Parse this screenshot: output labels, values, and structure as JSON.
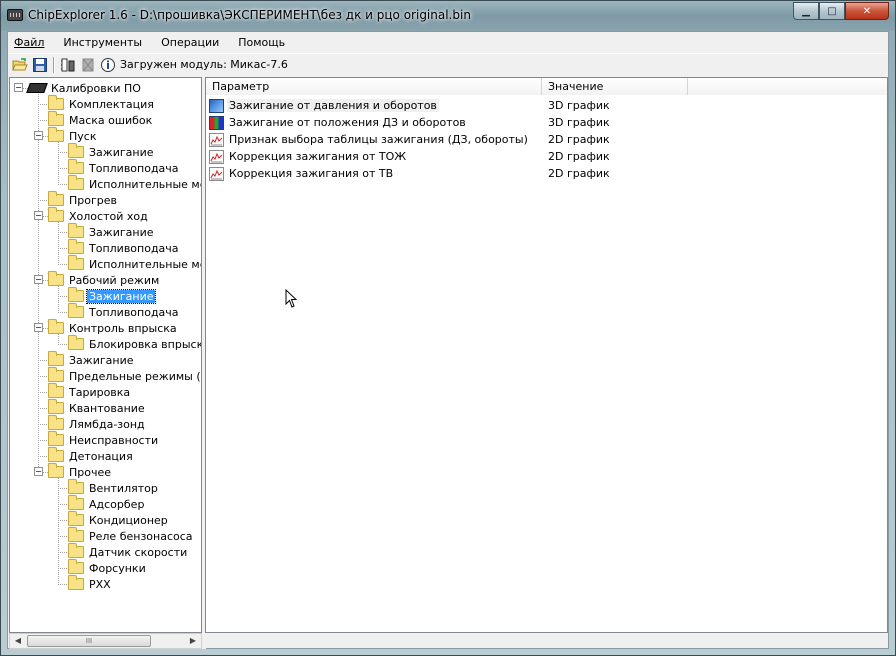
{
  "window": {
    "title": "ChipExplorer  1.6 - D:\\прошивка\\ЭКСПЕРИМЕНТ\\без дк и рцо original.bin",
    "minimize_glyph": "▁",
    "maximize_glyph": "□",
    "close_glyph": "✕"
  },
  "menu": {
    "items": [
      "Файл",
      "Инструменты",
      "Операции",
      "Помощь"
    ]
  },
  "toolbar": {
    "status": "Загружен модуль: Микас-7.6"
  },
  "tree": {
    "items": [
      {
        "label": "Калибровки ПО",
        "level": 0,
        "expander": "−",
        "icon": "chip"
      },
      {
        "label": "Комплектация",
        "level": 1,
        "expander": "",
        "icon": "folder"
      },
      {
        "label": "Маска ошибок",
        "level": 1,
        "expander": "",
        "icon": "folder"
      },
      {
        "label": "Пуск",
        "level": 1,
        "expander": "−",
        "icon": "folder"
      },
      {
        "label": "Зажигание",
        "level": 2,
        "expander": "",
        "icon": "folder"
      },
      {
        "label": "Топливоподача",
        "level": 2,
        "expander": "",
        "icon": "folder"
      },
      {
        "label": "Исполнительные меха",
        "level": 2,
        "expander": "",
        "icon": "folder"
      },
      {
        "label": "Прогрев",
        "level": 1,
        "expander": "",
        "icon": "folder"
      },
      {
        "label": "Холостой ход",
        "level": 1,
        "expander": "−",
        "icon": "folder"
      },
      {
        "label": "Зажигание",
        "level": 2,
        "expander": "",
        "icon": "folder"
      },
      {
        "label": "Топливоподача",
        "level": 2,
        "expander": "",
        "icon": "folder"
      },
      {
        "label": "Исполнительные меха",
        "level": 2,
        "expander": "",
        "icon": "folder"
      },
      {
        "label": "Рабочий режим",
        "level": 1,
        "expander": "−",
        "icon": "folder"
      },
      {
        "label": "Зажигание",
        "level": 2,
        "expander": "",
        "icon": "folder",
        "selected": true
      },
      {
        "label": "Топливоподача",
        "level": 2,
        "expander": "",
        "icon": "folder"
      },
      {
        "label": "Контроль впрыска",
        "level": 1,
        "expander": "−",
        "icon": "folder"
      },
      {
        "label": "Блокировка впрыска",
        "level": 2,
        "expander": "",
        "icon": "folder"
      },
      {
        "label": "Зажигание",
        "level": 1,
        "expander": "",
        "icon": "folder"
      },
      {
        "label": "Предельные режимы (вкл",
        "level": 1,
        "expander": "",
        "icon": "folder"
      },
      {
        "label": "Тарировка",
        "level": 1,
        "expander": "",
        "icon": "folder"
      },
      {
        "label": "Квантование",
        "level": 1,
        "expander": "",
        "icon": "folder"
      },
      {
        "label": "Лямбда-зонд",
        "level": 1,
        "expander": "",
        "icon": "folder"
      },
      {
        "label": "Неисправности",
        "level": 1,
        "expander": "",
        "icon": "folder"
      },
      {
        "label": "Детонация",
        "level": 1,
        "expander": "",
        "icon": "folder"
      },
      {
        "label": "Прочее",
        "level": 1,
        "expander": "−",
        "icon": "folder"
      },
      {
        "label": "Вентилятор",
        "level": 2,
        "expander": "",
        "icon": "folder"
      },
      {
        "label": "Адсорбер",
        "level": 2,
        "expander": "",
        "icon": "folder"
      },
      {
        "label": "Кондиционер",
        "level": 2,
        "expander": "",
        "icon": "folder"
      },
      {
        "label": "Реле бензонасоса",
        "level": 2,
        "expander": "",
        "icon": "folder"
      },
      {
        "label": "Датчик скорости",
        "level": 2,
        "expander": "",
        "icon": "folder"
      },
      {
        "label": "Форсунки",
        "level": 2,
        "expander": "",
        "icon": "folder"
      },
      {
        "label": "РХХ",
        "level": 2,
        "expander": "",
        "icon": "folder"
      }
    ]
  },
  "hscroll": {
    "left_arrow": "◀",
    "right_arrow": "▶",
    "grip": "III"
  },
  "list": {
    "columns": [
      "Параметр",
      "Значение"
    ],
    "rows": [
      {
        "name": "Зажигание от давления и оборотов",
        "value": "3D график",
        "icon": "3d-graph-icon",
        "highlight": true
      },
      {
        "name": "Зажигание от положения ДЗ и оборотов",
        "value": "3D график",
        "icon": "3d-graph-rgb-icon"
      },
      {
        "name": "Признак выбора таблицы зажигания (ДЗ, обороты)",
        "value": "2D график",
        "icon": "2d-graph-icon"
      },
      {
        "name": "Коррекция зажигания от ТОЖ",
        "value": "2D график",
        "icon": "2d-graph-icon"
      },
      {
        "name": "Коррекция зажигания от ТВ",
        "value": "2D график",
        "icon": "2d-graph-icon"
      }
    ]
  }
}
